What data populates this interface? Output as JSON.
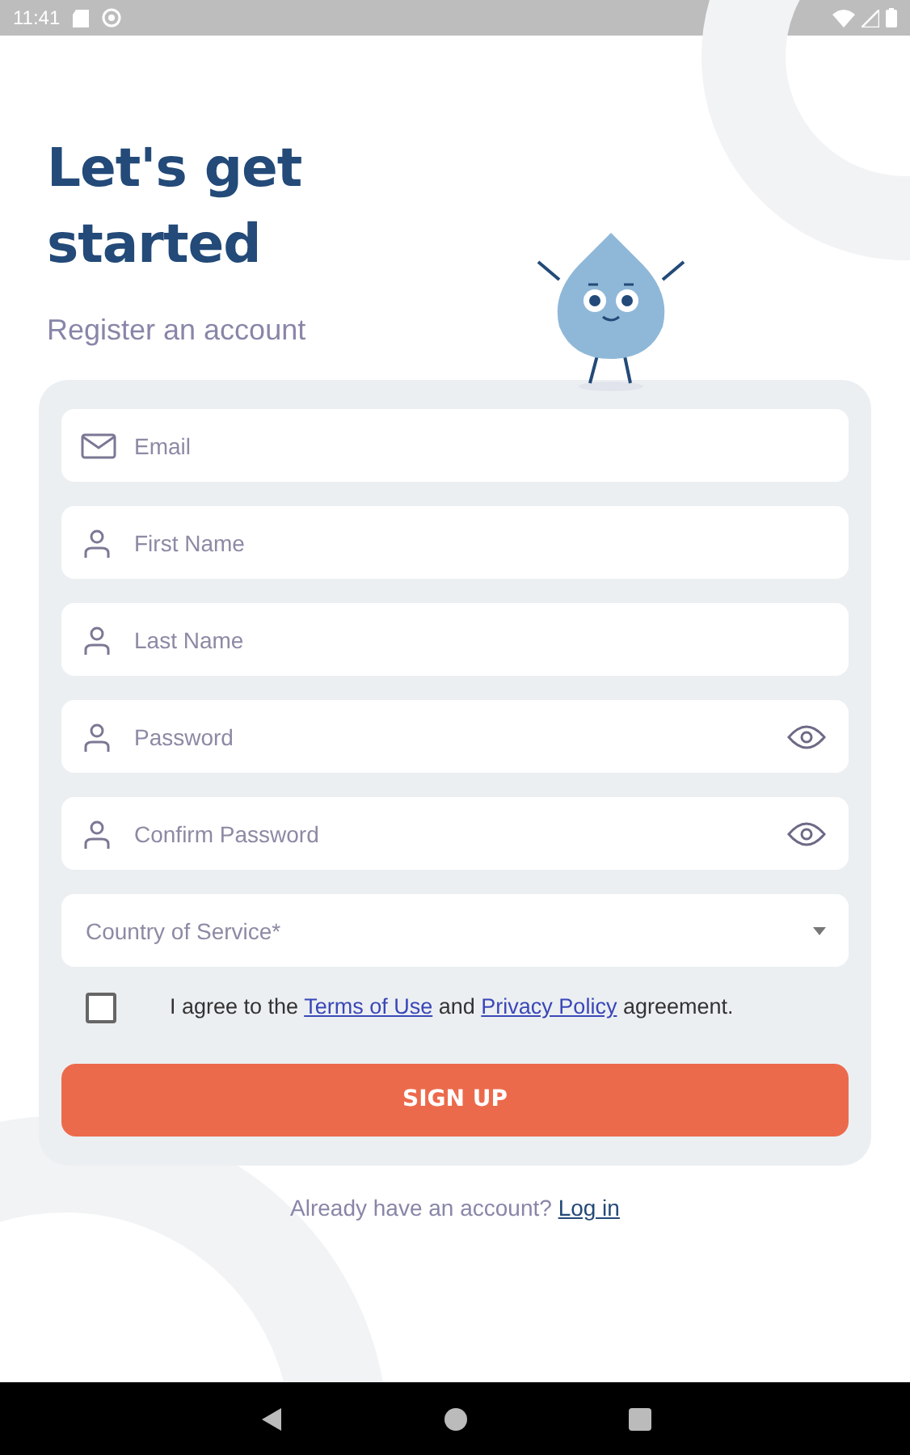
{
  "status_bar": {
    "time": "11:41"
  },
  "title": "Let's get started",
  "subtitle": "Register an account",
  "fields": [
    {
      "kind": "email",
      "placeholder": "Email"
    },
    {
      "kind": "name",
      "placeholder": "First Name"
    },
    {
      "kind": "name",
      "placeholder": "Last Name"
    },
    {
      "kind": "password",
      "placeholder": "Password"
    },
    {
      "kind": "password",
      "placeholder": "Confirm Password"
    },
    {
      "kind": "select",
      "placeholder": "Country of Service*"
    }
  ],
  "agreement": {
    "checked": false,
    "segments": [
      {
        "kind": "plain",
        "text": "I agree to the"
      },
      {
        "kind": "link",
        "text": "Terms of Use"
      },
      {
        "kind": "plain",
        "text": "and"
      },
      {
        "kind": "link",
        "text": "Privacy Policy"
      },
      {
        "kind": "plain",
        "text": "agreement."
      }
    ]
  },
  "submit": "SIGN UP",
  "footer": {
    "question": "Already have an account?",
    "link": "Log in"
  }
}
